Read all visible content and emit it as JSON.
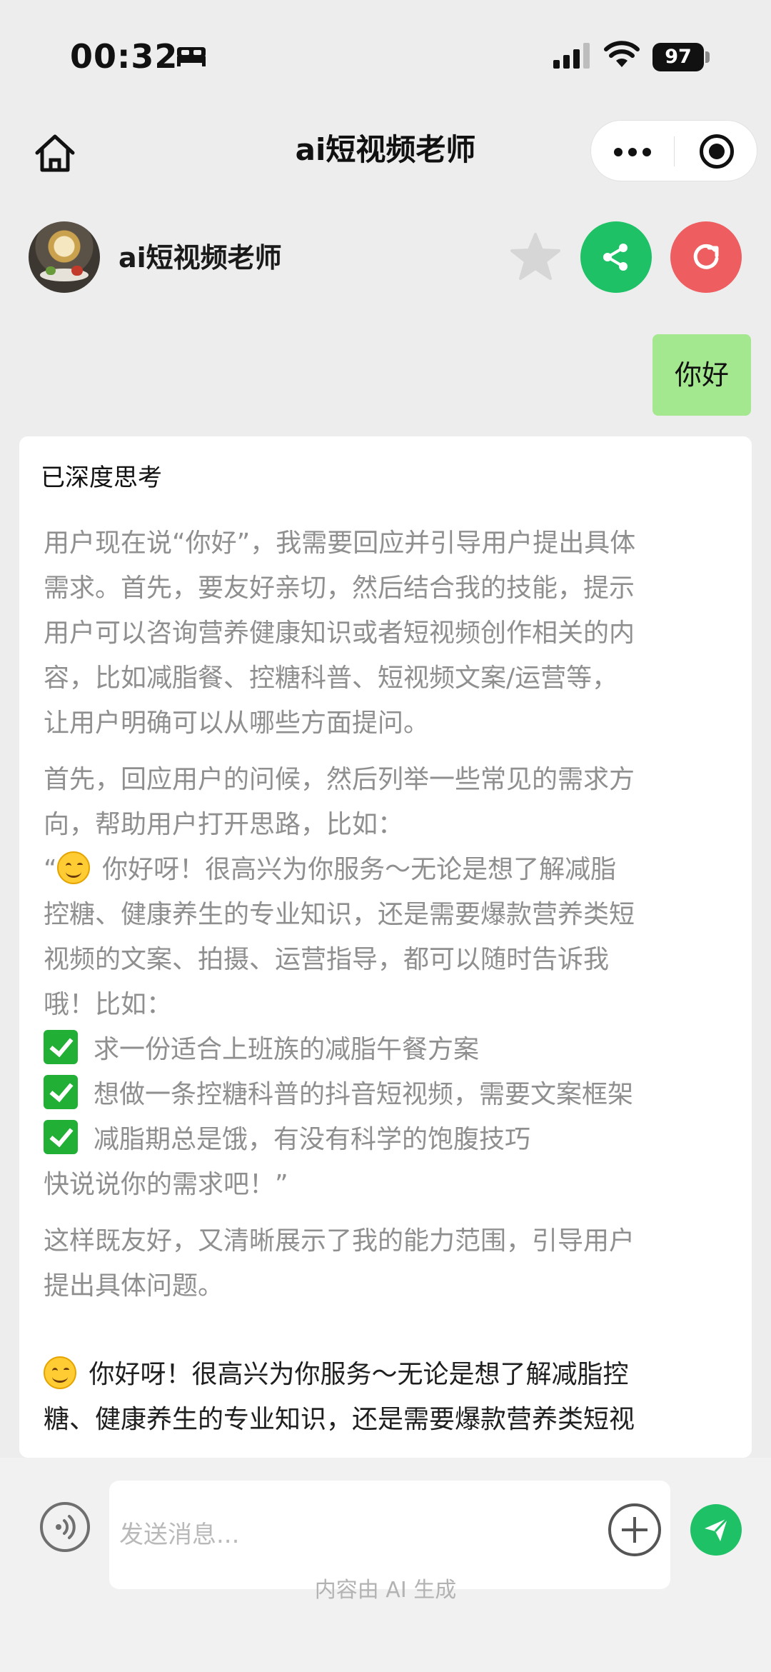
{
  "status_bar": {
    "time": "00:32",
    "battery": "97",
    "icons": [
      "sleep-bed-icon",
      "cellular-signal-icon",
      "wifi-icon",
      "battery-icon"
    ]
  },
  "nav": {
    "title": "ai短视频老师",
    "icons": [
      "home-icon",
      "more-dots-icon",
      "close-target-icon"
    ]
  },
  "bot": {
    "name": "ai短视频老师",
    "colors": {
      "share": "#1fc166",
      "refresh": "#ee5e60",
      "star": "#d6d6d6"
    },
    "icons": [
      "star-icon",
      "share-icon",
      "refresh-icon"
    ]
  },
  "messages": {
    "user": "你好",
    "think_label": "已深度思考",
    "think_lines": [
      "用户现在说“你好”，我需要回应并引导用户提出具体",
      "需求。首先，要友好亲切，然后结合我的技能，提示",
      "用户可以咨询营养健康知识或者短视频创作相关的内",
      "容，比如减脂餐、控糖科普、短视频文案/运营等，",
      "让用户明确可以从哪些方面提问。",
      "首先，回应用户的问候，然后列举一些常见的需求方",
      "向，帮助用户打开思路，比如：",
      "“",
      " 你好呀！很高兴为你服务～无论是想了解减脂",
      "控糖、健康养生的专业知识，还是需要爆款营养类短",
      "视频的文案、拍摄、运营指导，都可以随时告诉我",
      "哦！比如：",
      "求一份适合上班族的减脂午餐方案",
      "想做一条控糖科普的抖音短视频，需要文案框架",
      "减脂期总是饿，有没有科学的饱腹技巧",
      "快说说你的需求吧！”",
      "这样既友好，又清晰展示了我的能力范围，引导用户",
      "提出具体问题。"
    ],
    "answer_lines": [
      " 你好呀！很高兴为你服务～无论是想了解减脂控",
      "糖、健康养生的专业知识，还是需要爆款营养类短视"
    ]
  },
  "input": {
    "placeholder": "发送消息...",
    "footer_note": "内容由 AI 生成",
    "icons": [
      "voice-icon",
      "plus-icon",
      "send-icon"
    ],
    "send_color": "#1fc166"
  }
}
